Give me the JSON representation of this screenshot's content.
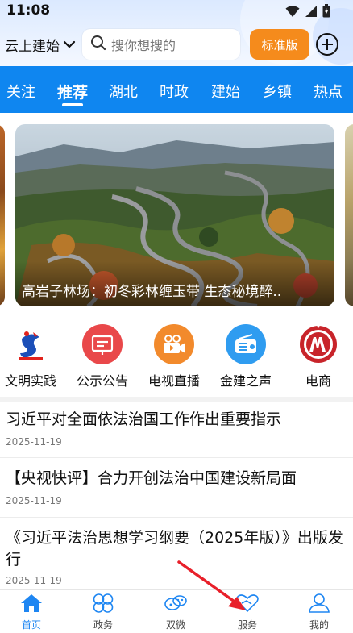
{
  "status_bar": {
    "time": "11:08"
  },
  "header": {
    "location": "云上建始",
    "search_placeholder": "搜你想搜的",
    "standard_button": "标准版"
  },
  "tabs": [
    {
      "label": "关注",
      "active": false
    },
    {
      "label": "推荐",
      "active": true
    },
    {
      "label": "湖北",
      "active": false
    },
    {
      "label": "时政",
      "active": false
    },
    {
      "label": "建始",
      "active": false
    },
    {
      "label": "乡镇",
      "active": false
    },
    {
      "label": "热点",
      "active": false
    }
  ],
  "carousel": {
    "caption": "高岩子林场：初冬彩林缠玉带 生态秘境醉.."
  },
  "quick_links": [
    {
      "label": "文明实践",
      "icon": "civilization-practice-logo-icon"
    },
    {
      "label": "公示公告",
      "icon": "announcement-board-icon"
    },
    {
      "label": "电视直播",
      "icon": "tv-live-camera-icon"
    },
    {
      "label": "金建之声",
      "icon": "radio-icon"
    },
    {
      "label": "电商",
      "icon": "ecommerce-logo-icon"
    }
  ],
  "news": [
    {
      "title": "习近平对全面依法治国工作作出重要指示",
      "date": "2025-11-19"
    },
    {
      "title": "【央视快评】合力开创法治中国建设新局面",
      "date": "2025-11-19"
    },
    {
      "title": "《习近平法治思想学习纲要（2025年版）》出版发行",
      "date": "2025-11-19"
    }
  ],
  "bottom_nav": [
    {
      "label": "首页",
      "icon": "home-icon",
      "active": true
    },
    {
      "label": "政务",
      "icon": "government-affairs-icon",
      "active": false
    },
    {
      "label": "双微",
      "icon": "weibo-wechat-icon",
      "active": false
    },
    {
      "label": "服务",
      "icon": "service-heart-icon",
      "active": false
    },
    {
      "label": "我的",
      "icon": "profile-icon",
      "active": false
    }
  ],
  "colors": {
    "primary_blue": "#0f86f0",
    "accent_orange": "#f58b1c",
    "annotation_red": "#e8202a"
  }
}
